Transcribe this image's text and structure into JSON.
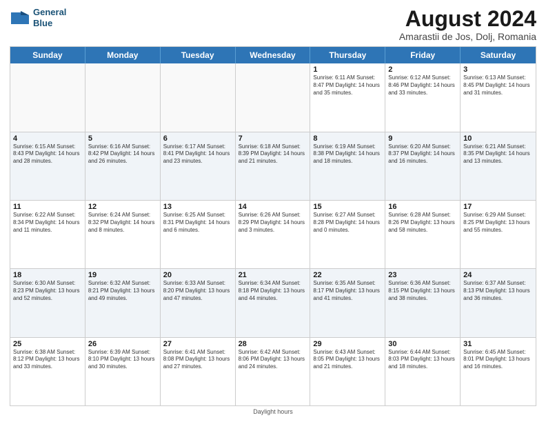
{
  "header": {
    "logo_line1": "General",
    "logo_line2": "Blue",
    "title": "August 2024",
    "subtitle": "Amarastii de Jos, Dolj, Romania"
  },
  "days_of_week": [
    "Sunday",
    "Monday",
    "Tuesday",
    "Wednesday",
    "Thursday",
    "Friday",
    "Saturday"
  ],
  "footer": {
    "note": "Daylight hours"
  },
  "weeks": [
    [
      {
        "day": "",
        "text": "",
        "empty": true
      },
      {
        "day": "",
        "text": "",
        "empty": true
      },
      {
        "day": "",
        "text": "",
        "empty": true
      },
      {
        "day": "",
        "text": "",
        "empty": true
      },
      {
        "day": "1",
        "text": "Sunrise: 6:11 AM\nSunset: 8:47 PM\nDaylight: 14 hours\nand 35 minutes.",
        "empty": false
      },
      {
        "day": "2",
        "text": "Sunrise: 6:12 AM\nSunset: 8:46 PM\nDaylight: 14 hours\nand 33 minutes.",
        "empty": false
      },
      {
        "day": "3",
        "text": "Sunrise: 6:13 AM\nSunset: 8:45 PM\nDaylight: 14 hours\nand 31 minutes.",
        "empty": false
      }
    ],
    [
      {
        "day": "4",
        "text": "Sunrise: 6:15 AM\nSunset: 8:43 PM\nDaylight: 14 hours\nand 28 minutes.",
        "empty": false
      },
      {
        "day": "5",
        "text": "Sunrise: 6:16 AM\nSunset: 8:42 PM\nDaylight: 14 hours\nand 26 minutes.",
        "empty": false
      },
      {
        "day": "6",
        "text": "Sunrise: 6:17 AM\nSunset: 8:41 PM\nDaylight: 14 hours\nand 23 minutes.",
        "empty": false
      },
      {
        "day": "7",
        "text": "Sunrise: 6:18 AM\nSunset: 8:39 PM\nDaylight: 14 hours\nand 21 minutes.",
        "empty": false
      },
      {
        "day": "8",
        "text": "Sunrise: 6:19 AM\nSunset: 8:38 PM\nDaylight: 14 hours\nand 18 minutes.",
        "empty": false
      },
      {
        "day": "9",
        "text": "Sunrise: 6:20 AM\nSunset: 8:37 PM\nDaylight: 14 hours\nand 16 minutes.",
        "empty": false
      },
      {
        "day": "10",
        "text": "Sunrise: 6:21 AM\nSunset: 8:35 PM\nDaylight: 14 hours\nand 13 minutes.",
        "empty": false
      }
    ],
    [
      {
        "day": "11",
        "text": "Sunrise: 6:22 AM\nSunset: 8:34 PM\nDaylight: 14 hours\nand 11 minutes.",
        "empty": false
      },
      {
        "day": "12",
        "text": "Sunrise: 6:24 AM\nSunset: 8:32 PM\nDaylight: 14 hours\nand 8 minutes.",
        "empty": false
      },
      {
        "day": "13",
        "text": "Sunrise: 6:25 AM\nSunset: 8:31 PM\nDaylight: 14 hours\nand 6 minutes.",
        "empty": false
      },
      {
        "day": "14",
        "text": "Sunrise: 6:26 AM\nSunset: 8:29 PM\nDaylight: 14 hours\nand 3 minutes.",
        "empty": false
      },
      {
        "day": "15",
        "text": "Sunrise: 6:27 AM\nSunset: 8:28 PM\nDaylight: 14 hours\nand 0 minutes.",
        "empty": false
      },
      {
        "day": "16",
        "text": "Sunrise: 6:28 AM\nSunset: 8:26 PM\nDaylight: 13 hours\nand 58 minutes.",
        "empty": false
      },
      {
        "day": "17",
        "text": "Sunrise: 6:29 AM\nSunset: 8:25 PM\nDaylight: 13 hours\nand 55 minutes.",
        "empty": false
      }
    ],
    [
      {
        "day": "18",
        "text": "Sunrise: 6:30 AM\nSunset: 8:23 PM\nDaylight: 13 hours\nand 52 minutes.",
        "empty": false
      },
      {
        "day": "19",
        "text": "Sunrise: 6:32 AM\nSunset: 8:21 PM\nDaylight: 13 hours\nand 49 minutes.",
        "empty": false
      },
      {
        "day": "20",
        "text": "Sunrise: 6:33 AM\nSunset: 8:20 PM\nDaylight: 13 hours\nand 47 minutes.",
        "empty": false
      },
      {
        "day": "21",
        "text": "Sunrise: 6:34 AM\nSunset: 8:18 PM\nDaylight: 13 hours\nand 44 minutes.",
        "empty": false
      },
      {
        "day": "22",
        "text": "Sunrise: 6:35 AM\nSunset: 8:17 PM\nDaylight: 13 hours\nand 41 minutes.",
        "empty": false
      },
      {
        "day": "23",
        "text": "Sunrise: 6:36 AM\nSunset: 8:15 PM\nDaylight: 13 hours\nand 38 minutes.",
        "empty": false
      },
      {
        "day": "24",
        "text": "Sunrise: 6:37 AM\nSunset: 8:13 PM\nDaylight: 13 hours\nand 36 minutes.",
        "empty": false
      }
    ],
    [
      {
        "day": "25",
        "text": "Sunrise: 6:38 AM\nSunset: 8:12 PM\nDaylight: 13 hours\nand 33 minutes.",
        "empty": false
      },
      {
        "day": "26",
        "text": "Sunrise: 6:39 AM\nSunset: 8:10 PM\nDaylight: 13 hours\nand 30 minutes.",
        "empty": false
      },
      {
        "day": "27",
        "text": "Sunrise: 6:41 AM\nSunset: 8:08 PM\nDaylight: 13 hours\nand 27 minutes.",
        "empty": false
      },
      {
        "day": "28",
        "text": "Sunrise: 6:42 AM\nSunset: 8:06 PM\nDaylight: 13 hours\nand 24 minutes.",
        "empty": false
      },
      {
        "day": "29",
        "text": "Sunrise: 6:43 AM\nSunset: 8:05 PM\nDaylight: 13 hours\nand 21 minutes.",
        "empty": false
      },
      {
        "day": "30",
        "text": "Sunrise: 6:44 AM\nSunset: 8:03 PM\nDaylight: 13 hours\nand 18 minutes.",
        "empty": false
      },
      {
        "day": "31",
        "text": "Sunrise: 6:45 AM\nSunset: 8:01 PM\nDaylight: 13 hours\nand 16 minutes.",
        "empty": false
      }
    ]
  ]
}
